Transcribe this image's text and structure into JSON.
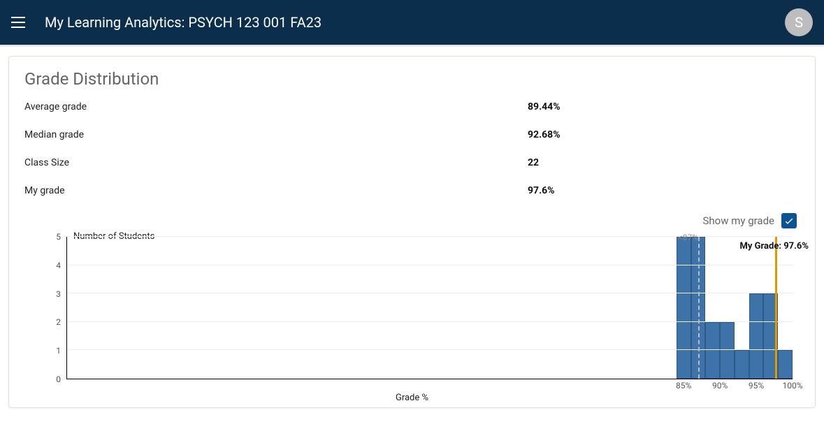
{
  "header": {
    "app_prefix": "My Learning Analytics:",
    "course": "PSYCH 123 001 FA23",
    "avatar_initial": "S"
  },
  "card": {
    "title": "Grade Distribution",
    "stats": [
      {
        "label": "Average grade",
        "value": "89.44%"
      },
      {
        "label": "Median grade",
        "value": "92.68%"
      },
      {
        "label": "Class Size",
        "value": "22"
      },
      {
        "label": "My grade",
        "value": "97.6%"
      }
    ],
    "toggle": {
      "label": "Show my grade",
      "checked": true
    }
  },
  "chart_data": {
    "type": "bar",
    "title": "Number of Students",
    "xlabel": "Grade %",
    "ylabel": "",
    "ylim": [
      0,
      5
    ],
    "y_ticks": [
      0,
      1,
      2,
      3,
      4,
      5
    ],
    "x_domain": [
      0,
      100
    ],
    "x_ticks": [
      85,
      90,
      95,
      100
    ],
    "x_tick_labels": [
      "85%",
      "90%",
      "95%",
      "100%"
    ],
    "bin_width": 2,
    "bins": [
      {
        "start": 84,
        "count": 5
      },
      {
        "start": 86,
        "count": 5
      },
      {
        "start": 88,
        "count": 2
      },
      {
        "start": 90,
        "count": 2
      },
      {
        "start": 92,
        "count": 1
      },
      {
        "start": 94,
        "count": 3
      },
      {
        "start": 96,
        "count": 3
      },
      {
        "start": 98,
        "count": 1
      }
    ],
    "cutoff": {
      "x": 87,
      "label": "<87%"
    },
    "my_grade": {
      "x": 97.6,
      "label": "My Grade: 97.6%"
    }
  }
}
